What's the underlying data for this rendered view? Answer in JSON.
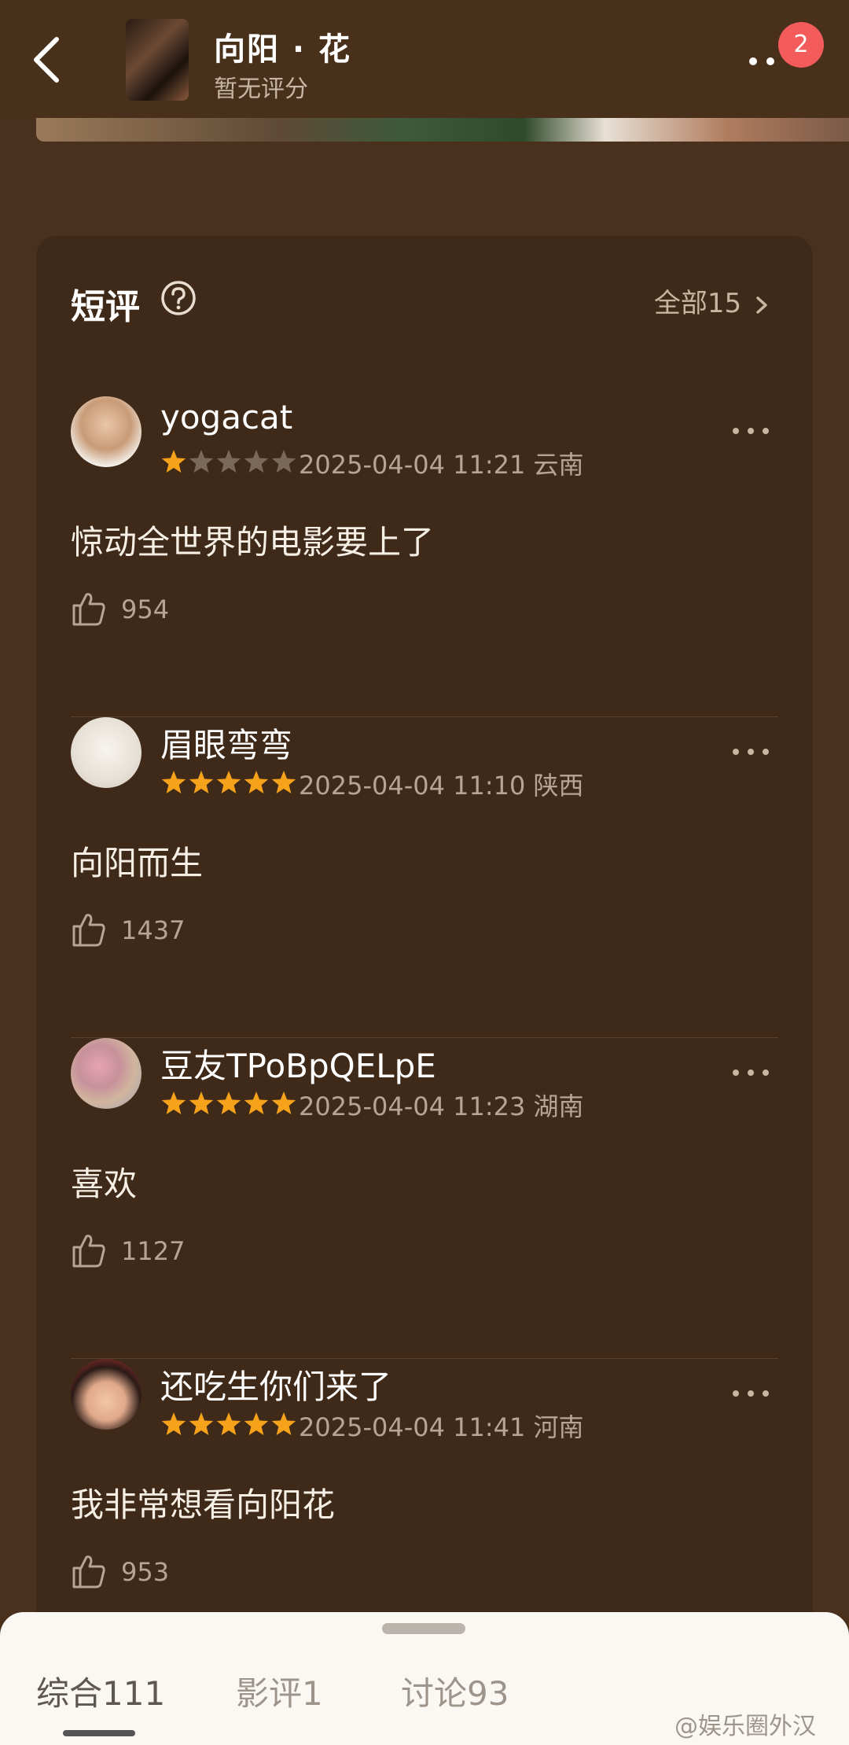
{
  "header": {
    "back_label": "返回",
    "title": "向阳 · 花",
    "subtitle": "暂无评分",
    "notification_count": "2"
  },
  "section": {
    "title": "短评",
    "all_label": "全部15"
  },
  "reviews": [
    {
      "user": "yogacat",
      "rating": 1,
      "date": "2025-04-04 11:21",
      "location": "云南",
      "content": "惊动全世界的电影要上了",
      "likes": "954"
    },
    {
      "user": "眉眼弯弯",
      "rating": 5,
      "date": "2025-04-04 11:10",
      "location": "陕西",
      "content": "向阳而生",
      "likes": "1437"
    },
    {
      "user": "豆友TPoBpQELpE",
      "rating": 5,
      "date": "2025-04-04 11:23",
      "location": "湖南",
      "content": "喜欢",
      "likes": "1127"
    },
    {
      "user": "还吃生你们来了",
      "rating": 5,
      "date": "2025-04-04 11:41",
      "location": "河南",
      "content": "我非常想看向阳花",
      "likes": "953"
    }
  ],
  "tabs": [
    {
      "label": "综合111",
      "active": true
    },
    {
      "label": "影评1",
      "active": false
    },
    {
      "label": "讨论93",
      "active": false
    }
  ],
  "watermark": "@娱乐圈外汉",
  "colors": {
    "star": "#f7a21b",
    "star_empty": "#7a6858",
    "badge": "#f45b5b",
    "bg": "#4a311d",
    "card": "#3f2918"
  }
}
